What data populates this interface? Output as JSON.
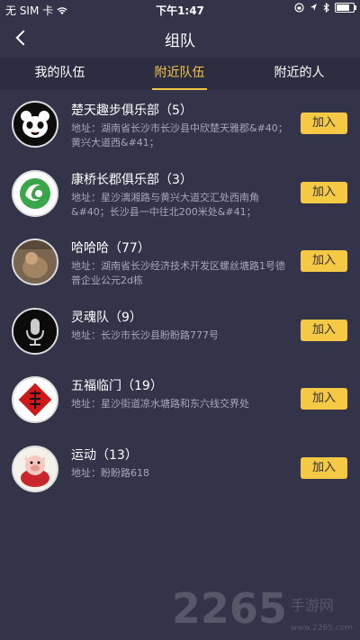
{
  "status": {
    "carrier": "无 SIM 卡",
    "time": "下午1:47",
    "battery_level": 0.85
  },
  "nav": {
    "title": "组队"
  },
  "tabs": [
    {
      "label": "我的队伍"
    },
    {
      "label": "附近队伍"
    },
    {
      "label": "附近的人"
    }
  ],
  "teams": [
    {
      "name": "楚天趣步俱乐部（5）",
      "address": "地址：湖南省长沙市长沙县中欣楚天雅郡&#40；黄兴大道西&#41；",
      "join": "加入"
    },
    {
      "name": "康桥长郡俱乐部（3）",
      "address": "地址：星沙漓湘路与黄兴大道交汇处西南角&#40；长沙县一中往北200米处&#41；",
      "join": "加入"
    },
    {
      "name": "哈哈哈（77）",
      "address": "地址：湖南省长沙经济技术开发区螺丝塘路1号德普企业公元2d栋",
      "join": "加入"
    },
    {
      "name": "灵魂队（9）",
      "address": "地址：长沙市长沙县盼盼路777号",
      "join": "加入"
    },
    {
      "name": "五福临门（19）",
      "address": "地址：星沙街道凉水塘路和东六线交界处",
      "join": "加入"
    },
    {
      "name": "运动（13）",
      "address": "地址：盼盼路618",
      "join": "加入"
    }
  ],
  "watermark": {
    "number": "2265",
    "text": "手游网",
    "url": "www.2265.com"
  }
}
